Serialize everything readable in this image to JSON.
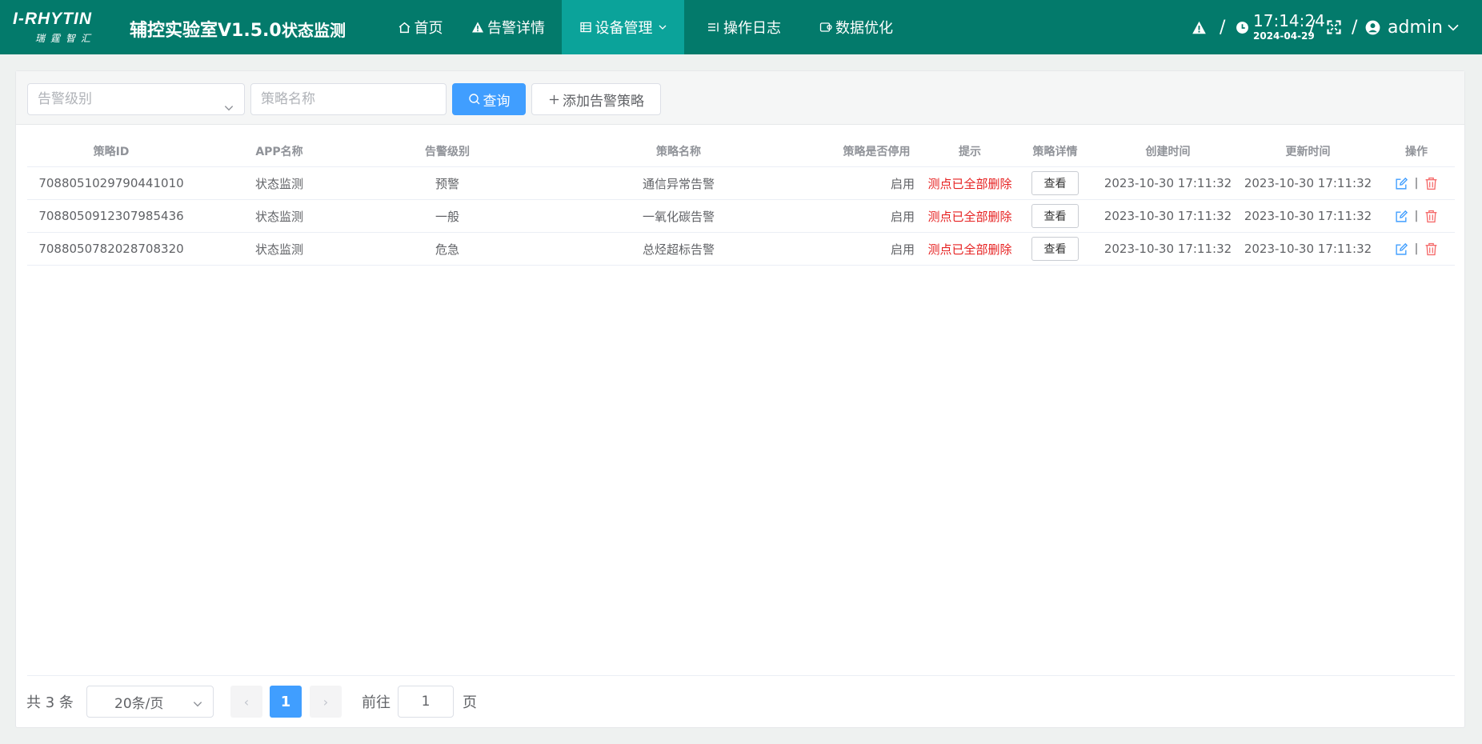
{
  "header": {
    "logo_main": "I-RHYTIN",
    "logo_sub": "瑞霆智汇",
    "system_title": "辅控实验室V1.5.0",
    "system_subtitle": "状态监测",
    "nav": [
      {
        "label": "首页",
        "icon": "home-icon"
      },
      {
        "label": "告警详情",
        "icon": "warning-icon"
      },
      {
        "label": "设备管理",
        "icon": "device-icon",
        "active": true
      },
      {
        "label": "操作日志",
        "icon": "log-icon"
      },
      {
        "label": "数据优化",
        "icon": "data-icon"
      }
    ],
    "separator": "/",
    "time": "17:14:24",
    "date": "2024-04-29",
    "user": "admin",
    "accent_color": "#037a6b",
    "active_nav_color": "#0ba39a"
  },
  "filters": {
    "level_placeholder": "告警级别",
    "name_placeholder": "策略名称",
    "query_label": "查询",
    "add_label": "添加告警策略"
  },
  "table": {
    "columns": [
      "策略ID",
      "APP名称",
      "告警级别",
      "策略名称",
      "策略是否停用",
      "提示",
      "策略详情",
      "创建时间",
      "更新时间",
      "操作"
    ],
    "rows": [
      {
        "id": "7088051029790441010",
        "app": "状态监测",
        "level": "预警",
        "name": "通信异常告警",
        "status": "启用",
        "hint": "测点已全部删除",
        "detail": "查看",
        "created": "2023-10-30 17:11:32",
        "updated": "2023-10-30 17:11:32"
      },
      {
        "id": "7088050912307985436",
        "app": "状态监测",
        "level": "一般",
        "name": "一氧化碳告警",
        "status": "启用",
        "hint": "测点已全部删除",
        "detail": "查看",
        "created": "2023-10-30 17:11:32",
        "updated": "2023-10-30 17:11:32"
      },
      {
        "id": "7088050782028708320",
        "app": "状态监测",
        "level": "危急",
        "name": "总烃超标告警",
        "status": "启用",
        "hint": "测点已全部删除",
        "detail": "查看",
        "created": "2023-10-30 17:11:32",
        "updated": "2023-10-30 17:11:32"
      }
    ],
    "op_separator": "|",
    "hint_color": "#e62020"
  },
  "pagination": {
    "total": "共 3 条",
    "page_size": "20条/页",
    "current_page": "1",
    "goto_label": "前往",
    "goto_value": "1",
    "page_unit": "页",
    "prev_glyph": "‹",
    "next_glyph": "›"
  }
}
